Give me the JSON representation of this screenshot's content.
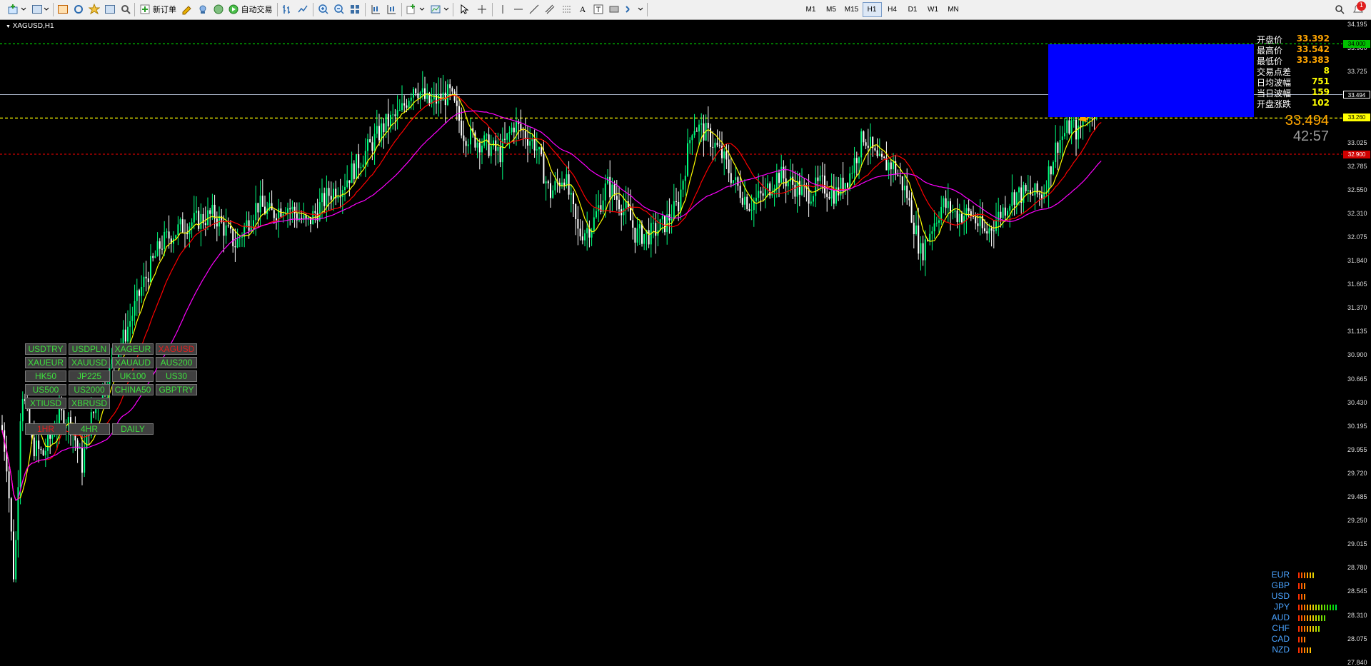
{
  "toolbar": {
    "new_order": "新订单",
    "auto_trade": "自动交易",
    "timeframes": [
      "M1",
      "M5",
      "M15",
      "H1",
      "H4",
      "D1",
      "W1",
      "MN"
    ],
    "active_timeframe": "H1",
    "notification_count": "1"
  },
  "chart": {
    "symbol": "XAGUSD,H1",
    "price_ticks": [
      "34.195",
      "33.960",
      "33.725",
      "33.494",
      "33.260",
      "33.025",
      "32.785",
      "32.550",
      "32.310",
      "32.075",
      "31.840",
      "31.605",
      "31.370",
      "31.135",
      "30.900",
      "30.665",
      "30.430",
      "30.195",
      "29.955",
      "29.720",
      "29.485",
      "29.250",
      "29.015",
      "28.780",
      "28.545",
      "28.310",
      "28.075",
      "27.840"
    ],
    "badges": {
      "green": "34.000",
      "white": "33.494",
      "yellow": "33.260",
      "red": "32.900"
    },
    "colors": {
      "background": "#000000",
      "bull_candle": "#00ff7f",
      "bear_candle": "#ffffff",
      "ma_fast": "#ffff00",
      "ma_mid": "#ff0000",
      "ma_slow": "#ff00ff",
      "green_line": "#00ff00",
      "yellow_line": "#ffff00",
      "red_line": "#ff0000",
      "info_panel": "#0000ff",
      "arrow": "#ffa500"
    }
  },
  "symbol_buttons": [
    {
      "label": "USDTRY",
      "active": false
    },
    {
      "label": "USDPLN",
      "active": false
    },
    {
      "label": "XAGEUR",
      "active": false
    },
    {
      "label": "XAGUSD",
      "active": true
    },
    {
      "label": "XAUEUR",
      "active": false
    },
    {
      "label": "XAUUSD",
      "active": false
    },
    {
      "label": "XAUAUD",
      "active": false
    },
    {
      "label": "AUS200",
      "active": false
    },
    {
      "label": "HK50",
      "active": false
    },
    {
      "label": "JP225",
      "active": false
    },
    {
      "label": "UK100",
      "active": false
    },
    {
      "label": "US30",
      "active": false
    },
    {
      "label": "US500",
      "active": false
    },
    {
      "label": "US2000",
      "active": false
    },
    {
      "label": "CHINA50",
      "active": false
    },
    {
      "label": "GBPTRY",
      "active": false
    },
    {
      "label": "XTIUSD",
      "active": false
    },
    {
      "label": "XBRUSD",
      "active": false
    }
  ],
  "timeframe_buttons": [
    {
      "label": "1HR",
      "active": true
    },
    {
      "label": "4HR",
      "active": false
    },
    {
      "label": "DAILY",
      "active": false
    }
  ],
  "info": {
    "rows": [
      {
        "label": "开盘价",
        "value": "33.392",
        "color": "#ffa500"
      },
      {
        "label": "最高价",
        "value": "33.542",
        "color": "#ffa500"
      },
      {
        "label": "最低价",
        "value": "33.383",
        "color": "#ffa500"
      },
      {
        "label": "交易点差",
        "value": "8",
        "color": "#ffff00"
      },
      {
        "label": "日均波幅",
        "value": "751",
        "color": "#ffff00"
      },
      {
        "label": "当日波幅",
        "value": "159",
        "color": "#ffff00"
      },
      {
        "label": "开盘涨跌",
        "value": "102",
        "color": "#ffff00"
      }
    ],
    "current_price": "33.494",
    "countdown": "42:57"
  },
  "currency_strength": [
    {
      "currency": "EUR",
      "level": 6
    },
    {
      "currency": "GBP",
      "level": 3
    },
    {
      "currency": "USD",
      "level": 3
    },
    {
      "currency": "JPY",
      "level": 14
    },
    {
      "currency": "AUD",
      "level": 10
    },
    {
      "currency": "CHF",
      "level": 8
    },
    {
      "currency": "CAD",
      "level": 3
    },
    {
      "currency": "NZD",
      "level": 5
    }
  ]
}
